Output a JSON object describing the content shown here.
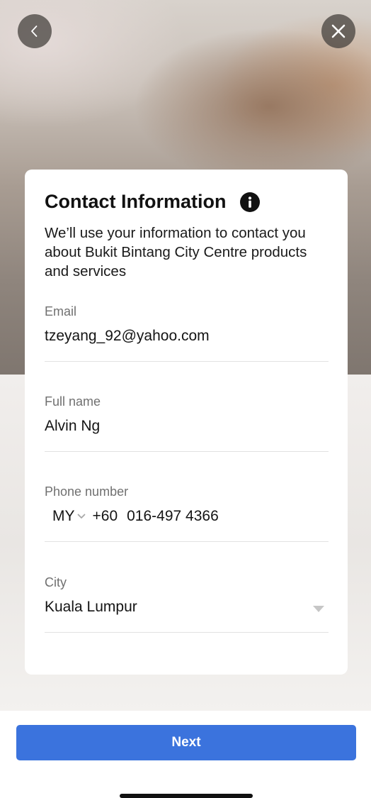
{
  "header": {
    "back_icon": "chevron-left-icon",
    "close_icon": "close-icon"
  },
  "card": {
    "title": "Contact Information",
    "info_icon": "info-icon",
    "description": "We’ll use your information to contact you about Bukit Bintang City Centre products and services"
  },
  "fields": {
    "email": {
      "label": "Email",
      "value": "tzeyang_92@yahoo.com"
    },
    "full_name": {
      "label": "Full name",
      "value": "Alvin Ng"
    },
    "phone": {
      "label": "Phone number",
      "country": "MY",
      "dial_code": "+60",
      "number": "016-497 4366"
    },
    "city": {
      "label": "City",
      "value": "Kuala Lumpur"
    }
  },
  "footer": {
    "next_label": "Next"
  },
  "colors": {
    "primary": "#3b73dd",
    "label": "#707070",
    "divider": "#e2e2e2"
  }
}
